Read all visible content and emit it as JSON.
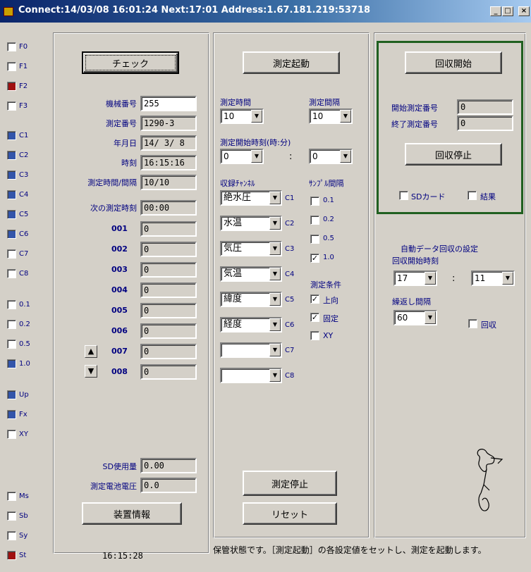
{
  "titlebar": {
    "title": "Connect:14/03/08 16:01:24 Next:17:01 Address:1.67.181.219:53718",
    "minimize": "_",
    "maximize": "□",
    "close": "×"
  },
  "sidebar": {
    "items": [
      {
        "label": "F0",
        "state": "off"
      },
      {
        "label": "F1",
        "state": "off"
      },
      {
        "label": "F2",
        "state": "red"
      },
      {
        "label": "F3",
        "state": "off"
      },
      {
        "label": "C1",
        "state": "blue"
      },
      {
        "label": "C2",
        "state": "blue"
      },
      {
        "label": "C3",
        "state": "blue"
      },
      {
        "label": "C4",
        "state": "blue"
      },
      {
        "label": "C5",
        "state": "blue"
      },
      {
        "label": "C6",
        "state": "blue"
      },
      {
        "label": "C7",
        "state": "off"
      },
      {
        "label": "C8",
        "state": "off"
      },
      {
        "label": "0.1",
        "state": "off"
      },
      {
        "label": "0.2",
        "state": "off"
      },
      {
        "label": "0.5",
        "state": "off"
      },
      {
        "label": "1.0",
        "state": "blue"
      },
      {
        "label": "Up",
        "state": "blue"
      },
      {
        "label": "Fx",
        "state": "blue"
      },
      {
        "label": "XY",
        "state": "off"
      },
      {
        "label": "Ms",
        "state": "off"
      },
      {
        "label": "Sb",
        "state": "off"
      },
      {
        "label": "Sy",
        "state": "off"
      },
      {
        "label": "St",
        "state": "red"
      }
    ]
  },
  "left": {
    "check_button": "チェック",
    "machine_no_label": "機械番号",
    "machine_no": "255",
    "measure_no_label": "測定番号",
    "measure_no": "1290-3",
    "date_label": "年月日",
    "date": "14/ 3/ 8",
    "time_label": "時刻",
    "time": "16:15:16",
    "interval_label": "測定時間/間隔",
    "interval": "10/10",
    "next_label": "次の測定時刻",
    "next": "00:00",
    "channels": [
      {
        "label": "001",
        "value": "0"
      },
      {
        "label": "002",
        "value": "0"
      },
      {
        "label": "003",
        "value": "0"
      },
      {
        "label": "004",
        "value": "0"
      },
      {
        "label": "005",
        "value": "0"
      },
      {
        "label": "006",
        "value": "0"
      },
      {
        "label": "007",
        "value": "0"
      },
      {
        "label": "008",
        "value": "0"
      }
    ],
    "up_arrow": "▲",
    "down_arrow": "▼",
    "sd_label": "SD使用量",
    "sd": "0.00",
    "battery_label": "測定電池電圧",
    "battery": "0.0",
    "device_info_button": "装置情報",
    "clock": "16:15:28"
  },
  "middle": {
    "start_button": "測定起動",
    "measure_time_label": "測定時間",
    "measure_time": "10",
    "measure_interval_label": "測定間隔",
    "measure_interval": "10",
    "start_time_label": "測定開始時刻(時:分)",
    "start_hour": "0",
    "colon": ":",
    "start_min": "0",
    "channel_label": "収録ﾁｬﾝﾈﾙ",
    "sample_label": "ｻﾝﾌﾟﾙ間隔",
    "channels": [
      {
        "value": "絶水圧",
        "tag": "C1"
      },
      {
        "value": "水温",
        "tag": "C2"
      },
      {
        "value": "気圧",
        "tag": "C3"
      },
      {
        "value": "気温",
        "tag": "C4"
      },
      {
        "value": "緯度",
        "tag": "C5"
      },
      {
        "value": "経度",
        "tag": "C6"
      },
      {
        "value": "",
        "tag": "C7"
      },
      {
        "value": "",
        "tag": "C8"
      }
    ],
    "samples": [
      {
        "label": "0.1",
        "checked": false
      },
      {
        "label": "0.2",
        "checked": false
      },
      {
        "label": "0.5",
        "checked": false
      },
      {
        "label": "1.0",
        "checked": true
      }
    ],
    "condition_label": "測定条件",
    "conditions": [
      {
        "label": "上向",
        "checked": true
      },
      {
        "label": "固定",
        "checked": true
      },
      {
        "label": "XY",
        "checked": false
      }
    ],
    "stop_button": "測定停止",
    "reset_button": "リセット"
  },
  "right": {
    "collect_start_button": "回収開始",
    "start_no_label": "開始測定番号",
    "start_no": "0",
    "end_no_label": "終了測定番号",
    "end_no": "0",
    "collect_stop_button": "回収停止",
    "sd_card_label": "SDカード",
    "result_label": "結果",
    "auto_title": "自動データ回収の設定",
    "auto_start_label": "回収開始時刻",
    "auto_hour": "17",
    "auto_colon": ":",
    "auto_min": "11",
    "repeat_label": "繰返し間隔",
    "repeat": "60",
    "collect_label": "回収"
  },
  "status": {
    "message": "保管状態です。［測定起動］の各設定値をセットし、測定を起動します。"
  }
}
